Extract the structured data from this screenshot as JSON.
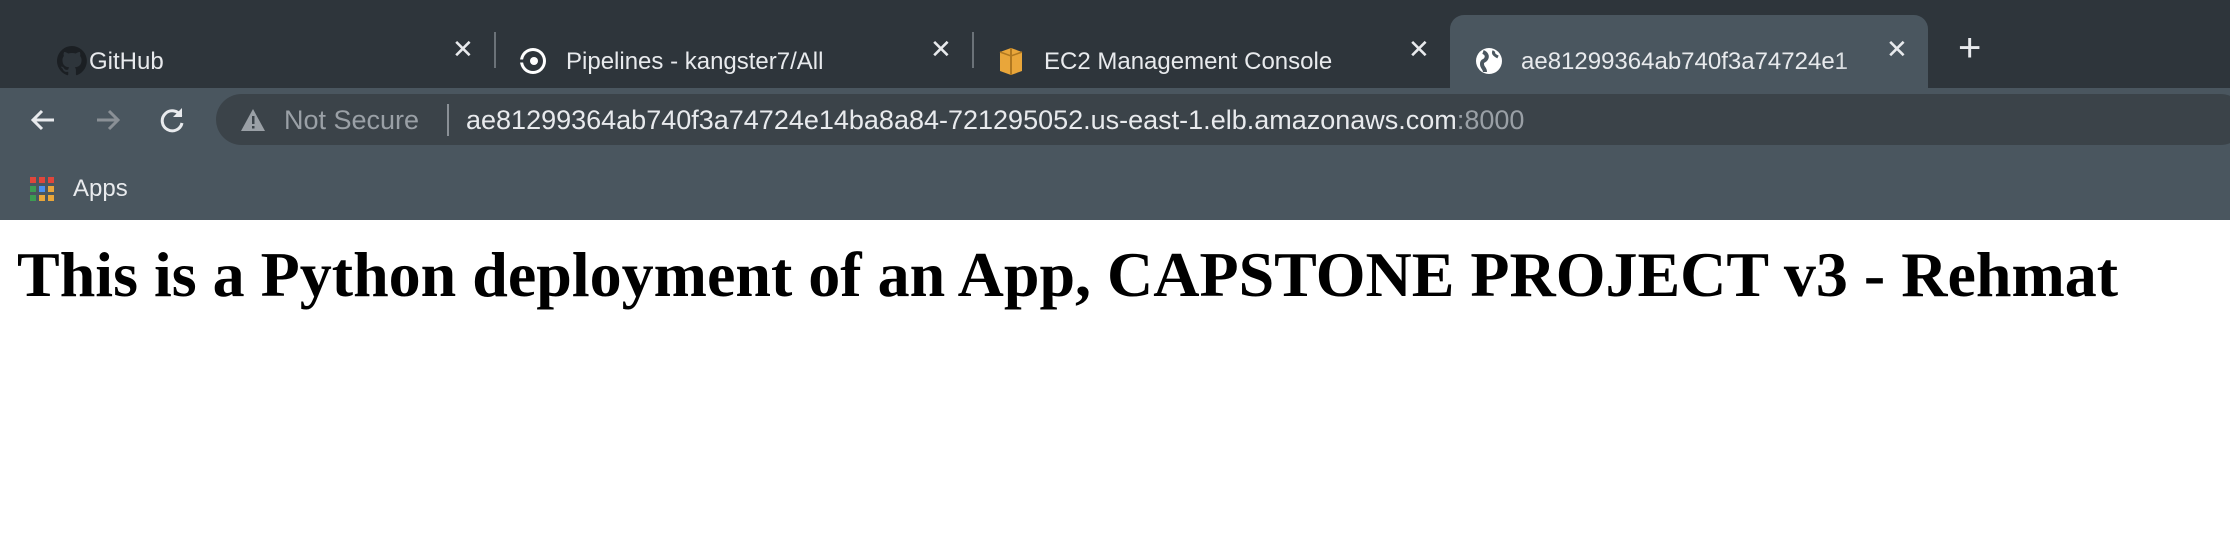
{
  "browser": {
    "tabs": [
      {
        "title": "GitHub",
        "icon": "github-icon"
      },
      {
        "title": "Pipelines - kangster7/All",
        "icon": "circleci-icon"
      },
      {
        "title": "EC2 Management Console",
        "icon": "aws-box-icon"
      },
      {
        "title": "ae81299364ab740f3a74724e1",
        "icon": "globe-icon",
        "active": true
      }
    ],
    "close_glyph": "✕",
    "new_tab_glyph": "+",
    "security_label": "Not Secure",
    "url_host": "ae81299364ab740f3a74724e14ba8a84-721295052.us-east-1.elb.amazonaws.com",
    "url_port": ":8000",
    "bookmarks": [
      {
        "label": "Apps",
        "icon": "apps-grid-icon"
      }
    ]
  },
  "page": {
    "heading": "This is a Python deployment of an App, CAPSTONE PROJECT v3 - Rehmat"
  },
  "colors": {
    "tabbar": "#2e353b",
    "toolbar": "#4a565f",
    "omnibox": "#3b4349"
  }
}
